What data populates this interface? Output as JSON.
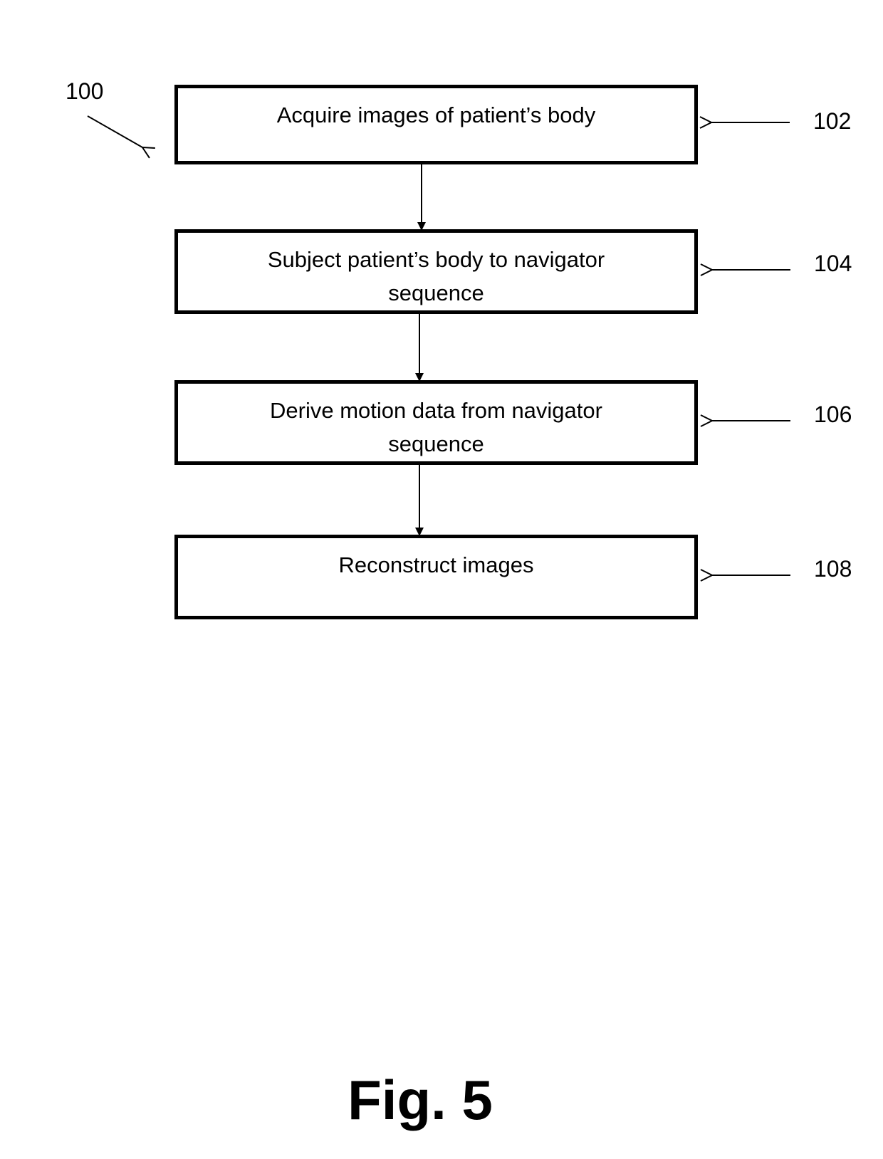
{
  "diagram": {
    "type": "flowchart",
    "overall_reference": "100",
    "steps": [
      {
        "ref": "102",
        "label": "Acquire images of patient’s body"
      },
      {
        "ref": "104",
        "label": "Subject patient’s body to navigator sequence"
      },
      {
        "ref": "106",
        "label": "Derive motion data from navigator sequence"
      },
      {
        "ref": "108",
        "label": "Reconstruct images"
      }
    ],
    "edges": [
      {
        "from": "102",
        "to": "104"
      },
      {
        "from": "104",
        "to": "106"
      },
      {
        "from": "106",
        "to": "108"
      }
    ],
    "caption": "Fig. 5"
  }
}
